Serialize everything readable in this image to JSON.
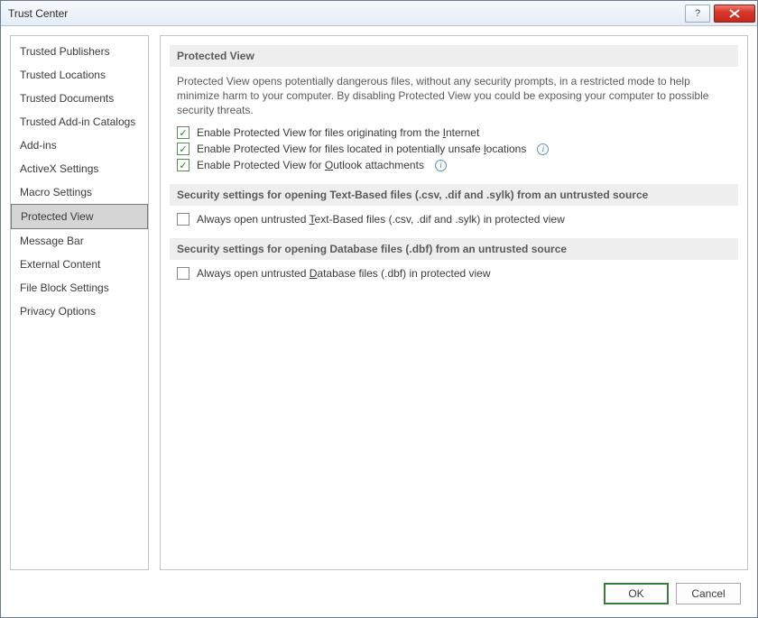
{
  "window": {
    "title": "Trust Center"
  },
  "sidebar": {
    "items": [
      {
        "label": "Trusted Publishers",
        "selected": false
      },
      {
        "label": "Trusted Locations",
        "selected": false
      },
      {
        "label": "Trusted Documents",
        "selected": false
      },
      {
        "label": "Trusted Add-in Catalogs",
        "selected": false
      },
      {
        "label": "Add-ins",
        "selected": false
      },
      {
        "label": "ActiveX Settings",
        "selected": false
      },
      {
        "label": "Macro Settings",
        "selected": false
      },
      {
        "label": "Protected View",
        "selected": true
      },
      {
        "label": "Message Bar",
        "selected": false
      },
      {
        "label": "External Content",
        "selected": false
      },
      {
        "label": "File Block Settings",
        "selected": false
      },
      {
        "label": "Privacy Options",
        "selected": false
      }
    ]
  },
  "main": {
    "section1": {
      "header": "Protected View",
      "description": "Protected View opens potentially dangerous files, without any security prompts, in a restricted mode to help minimize harm to your computer. By disabling Protected View you could be exposing your computer to possible security threats.",
      "opt1_pre": "Enable Protected View for files originating from the ",
      "opt1_u": "I",
      "opt1_post": "nternet",
      "opt2_pre": "Enable Protected View for files located in potentially unsafe ",
      "opt2_u": "l",
      "opt2_post": "ocations",
      "opt3_pre": "Enable Protected View for ",
      "opt3_u": "O",
      "opt3_post": "utlook attachments"
    },
    "section2": {
      "header": "Security settings for opening Text-Based files (.csv, .dif and .sylk) from an untrusted source",
      "opt_pre": "Always open untrusted ",
      "opt_u": "T",
      "opt_post": "ext-Based files (.csv, .dif and .sylk) in protected view"
    },
    "section3": {
      "header": "Security settings for opening Database files (.dbf) from an untrusted source",
      "opt_pre": "Always open untrusted ",
      "opt_u": "D",
      "opt_post": "atabase files (.dbf) in protected view"
    }
  },
  "footer": {
    "ok": "OK",
    "cancel": "Cancel"
  }
}
